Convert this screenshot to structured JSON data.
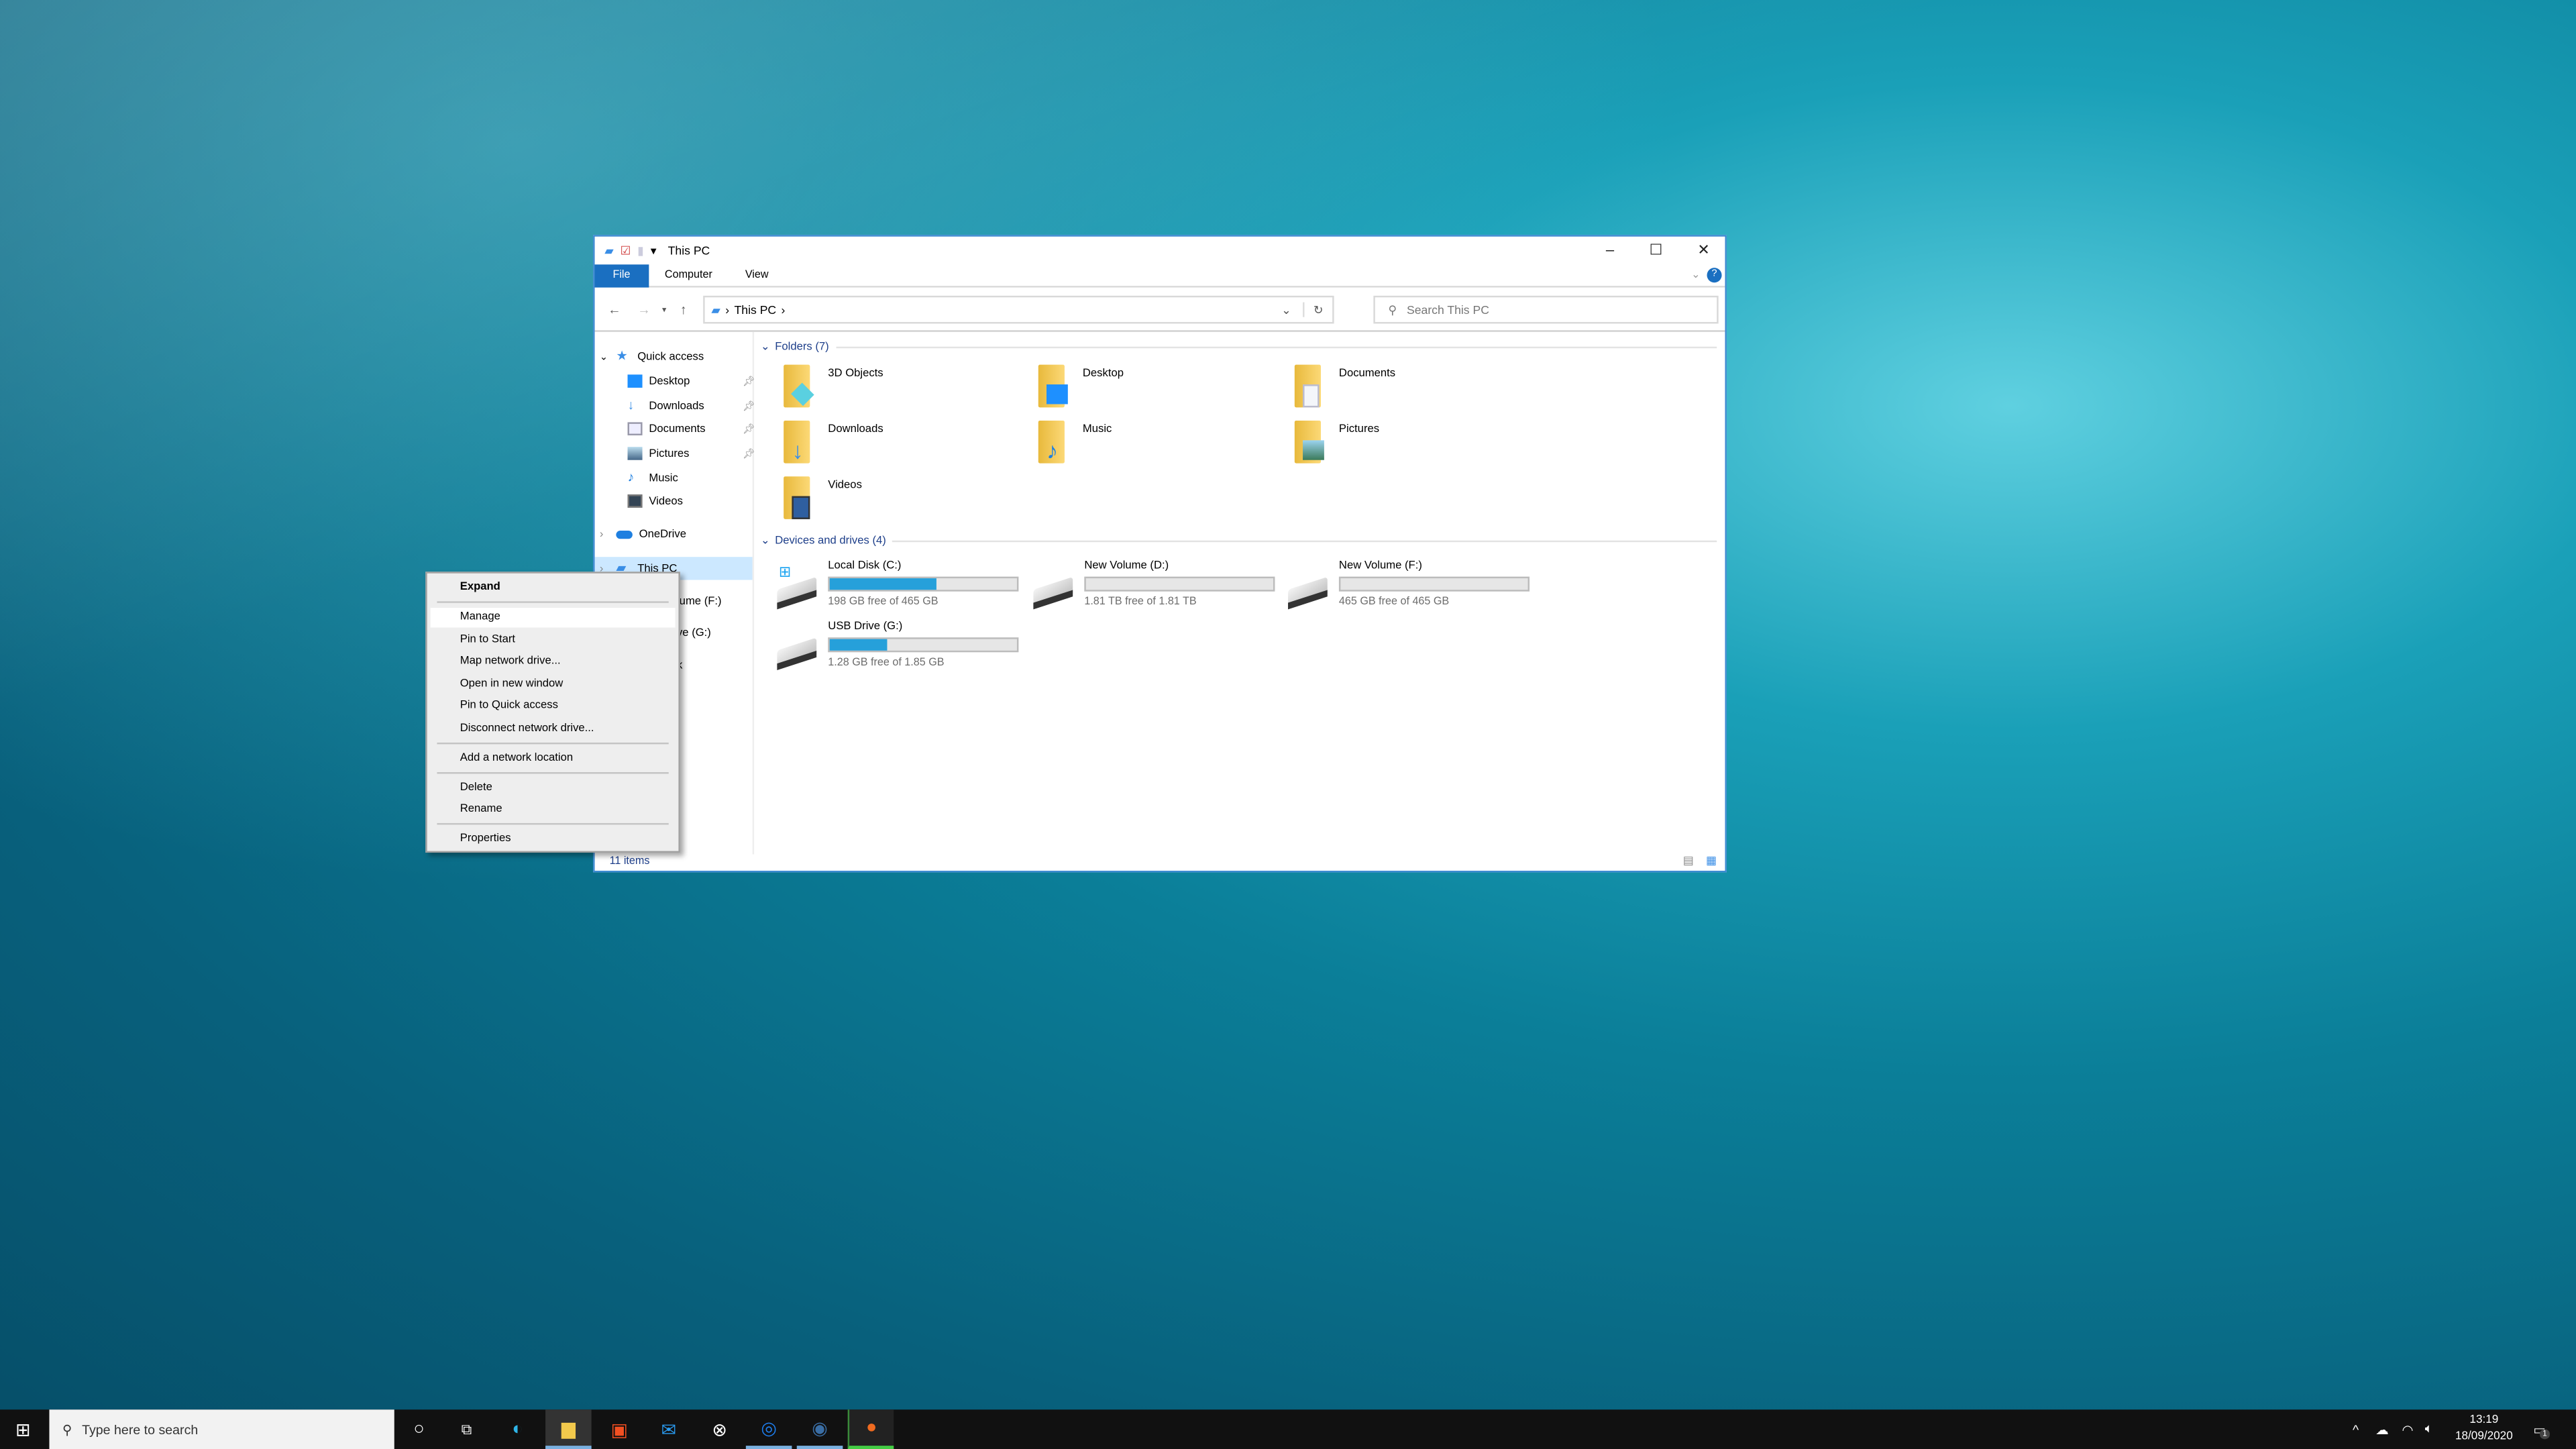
{
  "window": {
    "title": "This PC",
    "minimize": "–",
    "maximize": "☐",
    "close": "✕",
    "ribbon_tabs": [
      "File",
      "Computer",
      "View"
    ],
    "help": "?",
    "address": {
      "path": "This PC",
      "separator": "›"
    },
    "search": {
      "placeholder": "Search This PC"
    },
    "nav": [
      {
        "label": "Quick access",
        "icon": "star-icon",
        "expander": "⌄"
      },
      {
        "label": "Desktop",
        "icon": "desktop-icon",
        "pinned": true
      },
      {
        "label": "Downloads",
        "icon": "download-icon",
        "pinned": true
      },
      {
        "label": "Documents",
        "icon": "documents-icon",
        "pinned": true
      },
      {
        "label": "Pictures",
        "icon": "pictures-icon",
        "pinned": true
      },
      {
        "label": "Music",
        "icon": "music-icon"
      },
      {
        "label": "Videos",
        "icon": "videos-icon"
      },
      {
        "label": "OneDrive",
        "icon": "cloud-icon",
        "expander": "›"
      },
      {
        "label": "This PC",
        "icon": "computer-icon",
        "expander": "›",
        "selected": true
      },
      {
        "label": "lume (F:)"
      },
      {
        "label": "ve (G:)"
      },
      {
        "label": "k"
      }
    ],
    "folders_header": "Folders (7)",
    "folders": [
      {
        "name": "3D Objects"
      },
      {
        "name": "Desktop"
      },
      {
        "name": "Documents"
      },
      {
        "name": "Downloads"
      },
      {
        "name": "Music"
      },
      {
        "name": "Pictures"
      },
      {
        "name": "Videos"
      }
    ],
    "drives_header": "Devices and drives (4)",
    "drives": [
      {
        "name": "Local Disk (C:)",
        "info": "198 GB free of 465 GB",
        "used_fraction": 0.57
      },
      {
        "name": "New Volume (D:)",
        "info": "1.81 TB free of 1.81 TB",
        "used_fraction": 0.0
      },
      {
        "name": "New Volume (F:)",
        "info": "465 GB free of 465 GB",
        "used_fraction": 0.0
      },
      {
        "name": "USB Drive (G:)",
        "info": "1.28 GB free of 1.85 GB",
        "used_fraction": 0.31
      }
    ],
    "status": "11 items",
    "accent": "#1a6fc1",
    "bar_color": "#26a0da"
  },
  "context_menu": {
    "items": [
      "Expand",
      "Manage",
      "Pin to Start",
      "Map network drive...",
      "Open in new window",
      "Pin to Quick access",
      "Disconnect network drive...",
      "Add a network location",
      "Delete",
      "Rename",
      "Properties"
    ],
    "highlighted": "Manage"
  },
  "taskbar": {
    "search_placeholder": "Type here to search",
    "time": "13:19",
    "date": "18/09/2020",
    "notifications": "1",
    "apps": [
      "cortana-icon",
      "task-view-icon",
      "edge-icon",
      "file-explorer-icon",
      "store-icon",
      "mail-icon",
      "xbox-icon",
      "uplay-icon",
      "steam-icon",
      "origin-icon"
    ]
  }
}
